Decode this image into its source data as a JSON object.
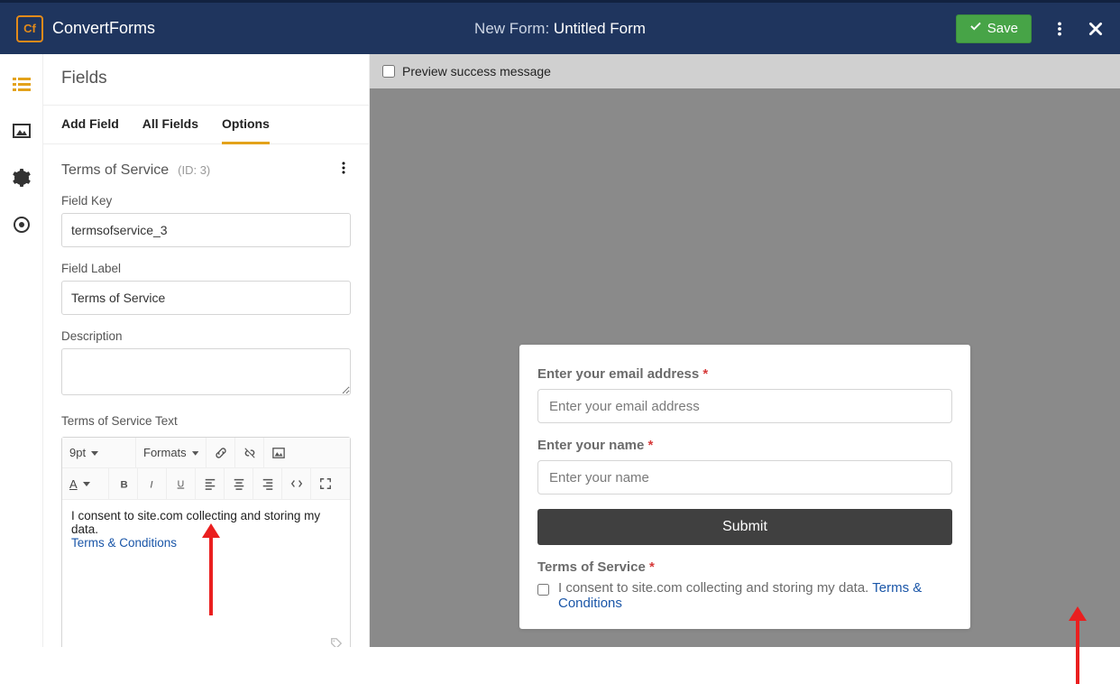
{
  "header": {
    "brand": "ConvertForms",
    "logo_text": "Cf",
    "title_prefix": "New Form:",
    "title_name": "Untitled Form",
    "save_label": "Save"
  },
  "rail": {
    "icons": [
      "list-icon",
      "image-icon",
      "gear-icon",
      "target-icon"
    ]
  },
  "sidebar": {
    "title": "Fields",
    "tabs": {
      "add": "Add Field",
      "all": "All Fields",
      "options": "Options"
    },
    "field": {
      "title": "Terms of Service",
      "id_label": "(ID: 3)",
      "key_label": "Field Key",
      "key_value": "termsofservice_3",
      "label_label": "Field Label",
      "label_value": "Terms of Service",
      "desc_label": "Description",
      "tos_label": "Terms of Service Text",
      "rte": {
        "fontsize": "9pt",
        "formats": "Formats",
        "text": "I consent to site.com collecting and storing my data.",
        "link_text": "Terms & Conditions"
      }
    }
  },
  "canvas": {
    "preview_checkbox_label": "Preview success message"
  },
  "preview": {
    "email_label": "Enter your email address",
    "email_placeholder": "Enter your email address",
    "name_label": "Enter your name",
    "name_placeholder": "Enter your name",
    "submit": "Submit",
    "tos_label": "Terms of Service",
    "tos_text": "I consent to site.com collecting and storing my data.",
    "tos_link": "Terms & Conditions"
  }
}
